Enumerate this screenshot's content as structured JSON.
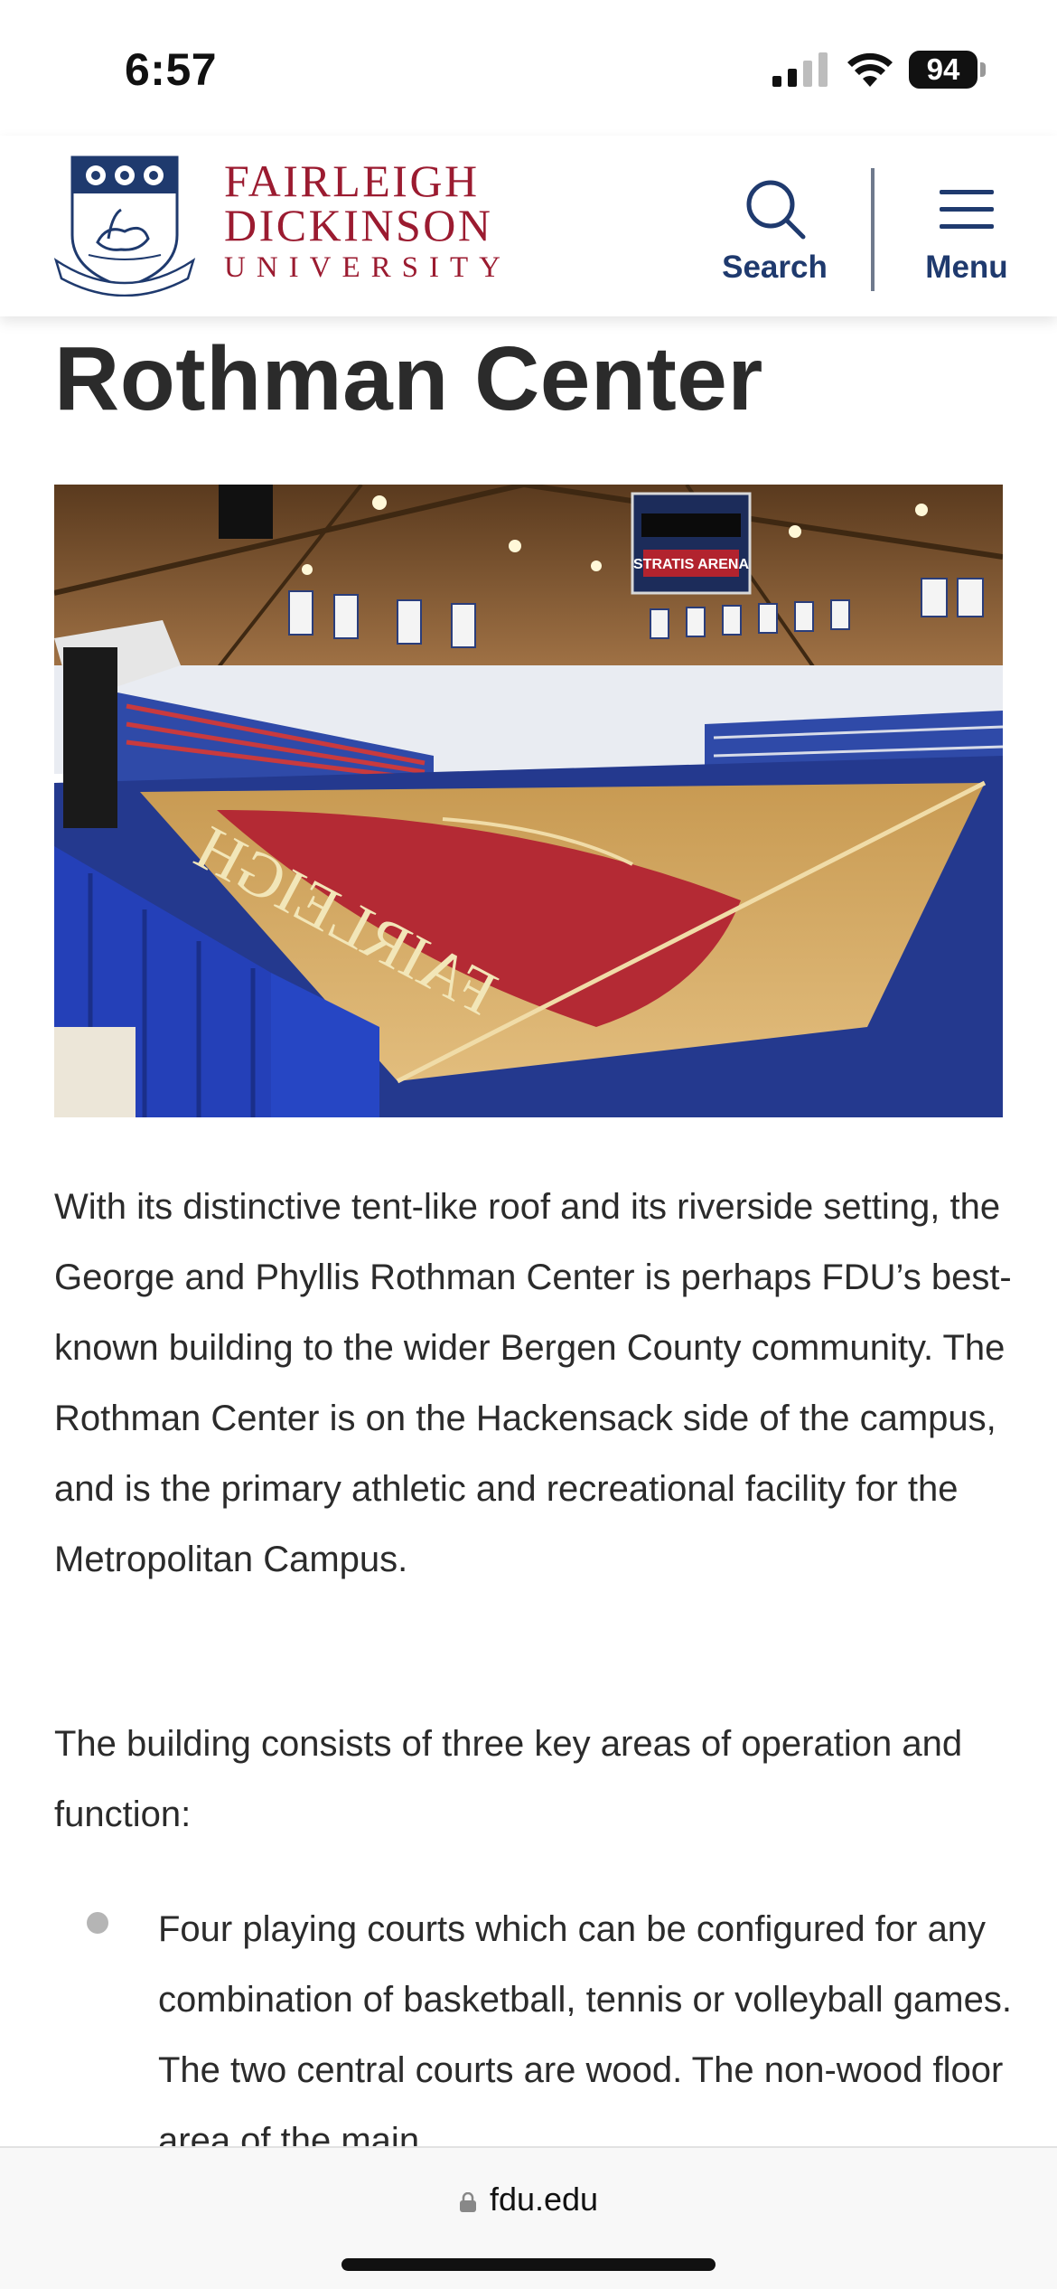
{
  "status_bar": {
    "time": "6:57",
    "battery": "94",
    "icons": [
      "signal-icon",
      "wifi-icon",
      "battery-icon"
    ]
  },
  "header": {
    "logo": {
      "line1": "FAIRLEIGH",
      "line2": "DICKINSON",
      "line3": "UNIVERSITY",
      "motto": "Fortiter et Suaviter"
    },
    "search_label": "Search",
    "menu_label": "Menu",
    "brand_color": "#9b1b30",
    "nav_color": "#1f3a6e"
  },
  "main": {
    "title": "Rothman Center",
    "hero_image": {
      "scoreboard": "STRATIS ARENA",
      "floor_text": "FAIRLEIGH"
    },
    "paragraphs": [
      "With its distinctive tent-like roof and its riverside setting, the George and Phyllis Rothman Center is perhaps FDU’s best-known building to the wider Bergen County community. The Rothman Center is on the Hackensack side of the campus, and is the primary athletic and recreational facility for the Metropolitan Campus.",
      "The building consists of three key areas of operation and function:"
    ],
    "bullets": [
      "Four playing courts which can be configured for any combination of basketball, tennis or volleyball games.  The two central courts are wood. The non-wood floor area of the main"
    ]
  },
  "browser": {
    "url": "fdu.edu"
  }
}
